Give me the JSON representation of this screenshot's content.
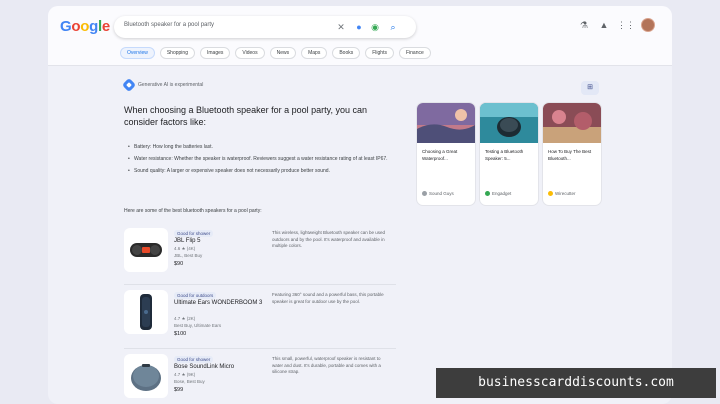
{
  "search": {
    "query": "Bluetooth speaker for a pool party",
    "clear_icon": "close-icon",
    "mic_icon": "mic-icon",
    "lens_icon": "camera-icon",
    "search_icon": "search-icon"
  },
  "tabs": [
    "Overview",
    "Shopping",
    "Images",
    "Videos",
    "News",
    "Maps",
    "Books",
    "Flights",
    "Finance"
  ],
  "ai_overview": {
    "label": "Generative AI is experimental",
    "headline": "When choosing a Bluetooth speaker for a pool party, you can consider factors like:",
    "bullets": [
      "Battery: How long the batteries last.",
      "Water resistance: Whether the speaker is waterproof. Reviewers suggest a water resistance rating of at least IP67.",
      "Sound quality: A larger or expensive speaker does not necessarily produce better sound."
    ],
    "intro": "Here are some of the best bluetooth speakers for a pool party:"
  },
  "products": [
    {
      "badge": "Good for shower",
      "name": "JBL Flip 5",
      "rating": "4.6 ★ (4K)",
      "seller": "JBL, Best Buy",
      "price": "$90",
      "desc": "This wireless, lightweight Bluetooth speaker can be used outdoors and by the pool. It's waterproof and available in multiple colors."
    },
    {
      "badge": "Good for outdoors",
      "name": "Ultimate Ears WONDERBOOM 3",
      "rating": "4.7 ★ (2K)",
      "seller": "Best Buy, Ultimate Ears",
      "price": "$100",
      "desc": "Featuring 360° sound and a powerful bass, this portable speaker is great for outdoor use by the pool."
    },
    {
      "badge": "Good for shower",
      "name": "Bose SoundLink Micro",
      "rating": "4.7 ★ (9K)",
      "seller": "Bose, Best Buy",
      "price": "$99",
      "desc": "This small, powerful, waterproof speaker is resistant to water and dust. It's durable, portable and comes with a silicone strap."
    }
  ],
  "cards": [
    {
      "title": "Choosing a Great Waterproof...",
      "source": "Sound Guys",
      "color": "#9aa0a6"
    },
    {
      "title": "Testing a Bluetooth Speaker: 5...",
      "source": "Engadget",
      "color": "#34a853"
    },
    {
      "title": "How To Buy The Best Bluetooth...",
      "source": "Wirecutter",
      "color": "#fbbc05"
    }
  ],
  "header_icons": [
    "labs-icon",
    "notifications-icon",
    "apps-grid-icon"
  ],
  "watermark": "businesscarddiscounts.com"
}
